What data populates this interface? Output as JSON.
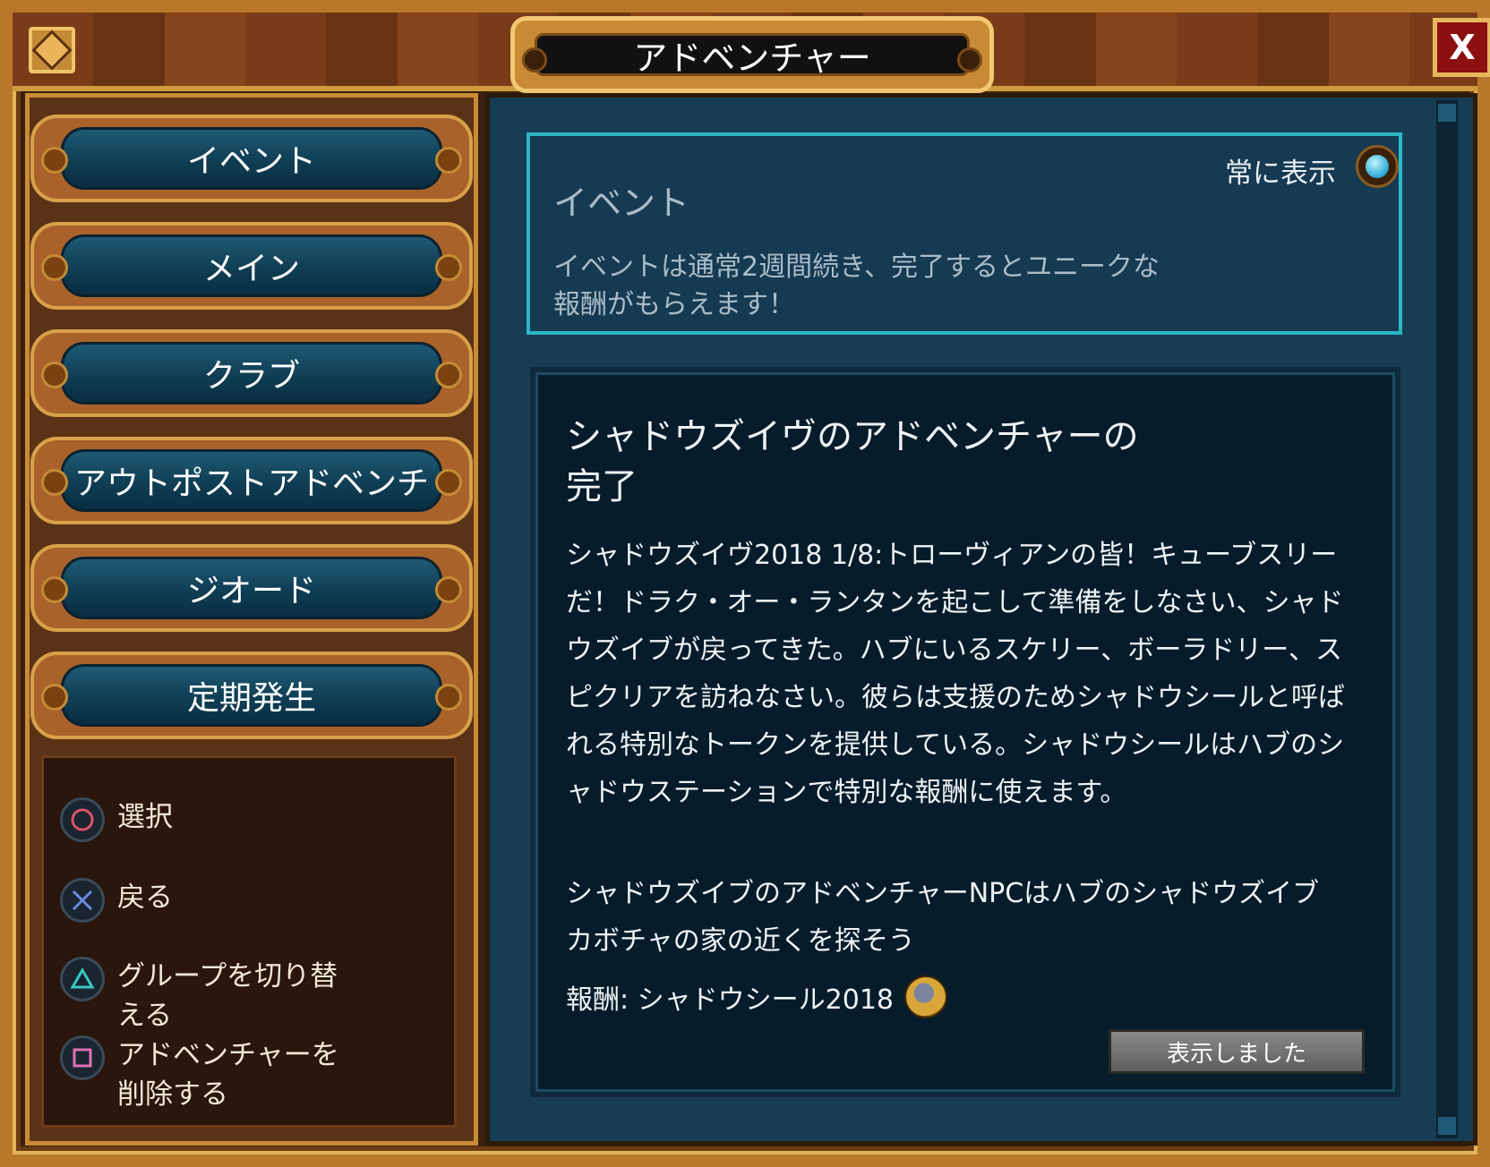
{
  "window": {
    "title": "アドベンチャー",
    "close_label": "X"
  },
  "nav": {
    "items": [
      {
        "label": "イベント"
      },
      {
        "label": "メイン"
      },
      {
        "label": "クラブ"
      },
      {
        "label": "アウトポストアドベンチ"
      },
      {
        "label": "ジオード"
      },
      {
        "label": "定期発生"
      }
    ]
  },
  "controls": [
    {
      "icon": "circle-button-icon",
      "label": "選択"
    },
    {
      "icon": "cross-button-icon",
      "label": "戻る"
    },
    {
      "icon": "triangle-button-icon",
      "label": "グループを切り替える"
    },
    {
      "icon": "square-button-icon",
      "label": "アドベンチャーを削除する"
    }
  ],
  "category": {
    "title": "イベント",
    "description": "イベントは通常2週間続き、完了するとユニークな報酬がもらえます！",
    "always_show_label": "常に表示"
  },
  "adventure": {
    "title": "シャドウズイヴのアドベンチャーの完了",
    "body": "シャドウズイヴ2018 1/8:トローヴィアンの皆！キューブスリーだ！ドラク・オー・ランタンを起こして準備をしなさい、シャドウズイブが戻ってきた。ハブにいるスケリー、ボーラドリー、スピクリアを訪ねなさい。彼らは支援のためシャドウシールと呼ばれる特別なトークンを提供している。シャドウシールはハブのシャドウステーションで特別な報酬に使えます。",
    "body2": "シャドウズイブのアドベンチャーNPCはハブのシャドウズイブカボチャの家の近くを探そう",
    "reward": "報酬: シャドウシール2018",
    "seen_button": "表示しました"
  },
  "colors": {
    "frame": "#b8782a",
    "panel_blue": "#173d55",
    "accent_cyan": "#2bb8c4",
    "button_face": "#0f3e54"
  }
}
